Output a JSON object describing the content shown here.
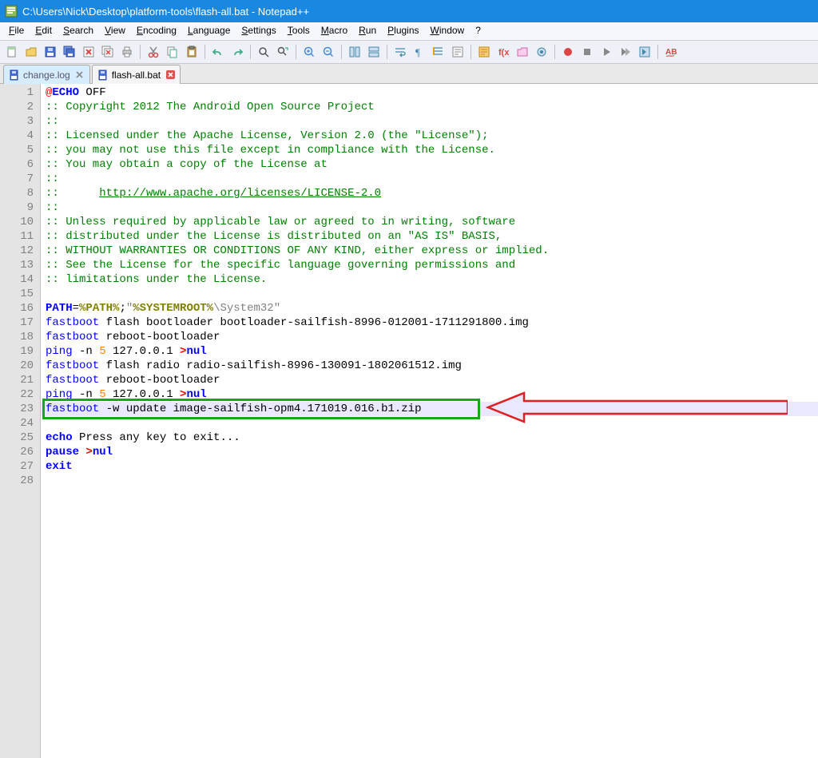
{
  "window": {
    "title": "C:\\Users\\Nick\\Desktop\\platform-tools\\flash-all.bat - Notepad++"
  },
  "menu": {
    "items": [
      {
        "label": "File",
        "mn": "F"
      },
      {
        "label": "Edit",
        "mn": "E"
      },
      {
        "label": "Search",
        "mn": "S"
      },
      {
        "label": "View",
        "mn": "V"
      },
      {
        "label": "Encoding",
        "mn": "E"
      },
      {
        "label": "Language",
        "mn": "L"
      },
      {
        "label": "Settings",
        "mn": "S"
      },
      {
        "label": "Tools",
        "mn": "T"
      },
      {
        "label": "Macro",
        "mn": "M"
      },
      {
        "label": "Run",
        "mn": "R"
      },
      {
        "label": "Plugins",
        "mn": "P"
      },
      {
        "label": "Window",
        "mn": "W"
      },
      {
        "label": "?",
        "mn": "?"
      }
    ]
  },
  "tabs": [
    {
      "name": "change.log",
      "active": false
    },
    {
      "name": "flash-all.bat",
      "active": true
    }
  ],
  "code": {
    "lines": [
      [
        {
          "t": "@",
          "c": "at"
        },
        {
          "t": "ECHO",
          "c": "kw"
        },
        {
          "t": " OFF"
        }
      ],
      [
        {
          "t": ":: Copyright 2012 The Android Open Source Project",
          "c": "cm"
        }
      ],
      [
        {
          "t": "::",
          "c": "cm"
        }
      ],
      [
        {
          "t": ":: Licensed under the Apache License, Version 2.0 (the \"License\");",
          "c": "cm"
        }
      ],
      [
        {
          "t": ":: you may not use this file except in compliance with the License.",
          "c": "cm"
        }
      ],
      [
        {
          "t": ":: You may obtain a copy of the License at",
          "c": "cm"
        }
      ],
      [
        {
          "t": "::",
          "c": "cm"
        }
      ],
      [
        {
          "t": "::      ",
          "c": "cm"
        },
        {
          "t": "http://www.apache.org/licenses/LICENSE-2.0",
          "c": "cm lnk"
        }
      ],
      [
        {
          "t": "::",
          "c": "cm"
        }
      ],
      [
        {
          "t": ":: Unless required by applicable law or agreed to in writing, software",
          "c": "cm"
        }
      ],
      [
        {
          "t": ":: distributed under the License is distributed on an \"AS IS\" BASIS,",
          "c": "cm"
        }
      ],
      [
        {
          "t": ":: WITHOUT WARRANTIES OR CONDITIONS OF ANY KIND, either express or implied.",
          "c": "cm"
        }
      ],
      [
        {
          "t": ":: See the License for the specific language governing permissions and",
          "c": "cm"
        }
      ],
      [
        {
          "t": ":: limitations under the License.",
          "c": "cm"
        }
      ],
      [],
      [
        {
          "t": "PATH",
          "c": "kw"
        },
        {
          "t": "="
        },
        {
          "t": "%PATH%",
          "c": "var"
        },
        {
          "t": ";"
        },
        {
          "t": "\"",
          "c": "str"
        },
        {
          "t": "%SYSTEMROOT%",
          "c": "var"
        },
        {
          "t": "\\System32\"",
          "c": "str"
        }
      ],
      [
        {
          "t": "fastboot",
          "c": "kw2"
        },
        {
          "t": " flash bootloader bootloader-sailfish-8996-012001-1711291800.img"
        }
      ],
      [
        {
          "t": "fastboot",
          "c": "kw2"
        },
        {
          "t": " reboot-bootloader"
        }
      ],
      [
        {
          "t": "ping",
          "c": "kw2"
        },
        {
          "t": " -n "
        },
        {
          "t": "5",
          "c": "num"
        },
        {
          "t": " 127.0.0.1 "
        },
        {
          "t": ">",
          "c": "redir"
        },
        {
          "t": "nul",
          "c": "kw"
        }
      ],
      [
        {
          "t": "fastboot",
          "c": "kw2"
        },
        {
          "t": " flash radio radio-sailfish-8996-130091-1802061512.img"
        }
      ],
      [
        {
          "t": "fastboot",
          "c": "kw2"
        },
        {
          "t": " reboot-bootloader"
        }
      ],
      [
        {
          "t": "ping",
          "c": "kw2"
        },
        {
          "t": " -n "
        },
        {
          "t": "5",
          "c": "num"
        },
        {
          "t": " 127.0.0.1 "
        },
        {
          "t": ">",
          "c": "redir"
        },
        {
          "t": "nul",
          "c": "kw"
        }
      ],
      [
        {
          "t": "fastboot",
          "c": "kw2"
        },
        {
          "t": " -w update image-sailfish-opm4.171019.016.b1.zip"
        }
      ],
      [],
      [
        {
          "t": "echo",
          "c": "kw"
        },
        {
          "t": " Press any key to exit..."
        }
      ],
      [
        {
          "t": "pause",
          "c": "kw"
        },
        {
          "t": " "
        },
        {
          "t": ">",
          "c": "redir"
        },
        {
          "t": "nul",
          "c": "kw"
        }
      ],
      [
        {
          "t": "exit",
          "c": "kw"
        }
      ],
      []
    ],
    "highlightedLine": 23
  }
}
